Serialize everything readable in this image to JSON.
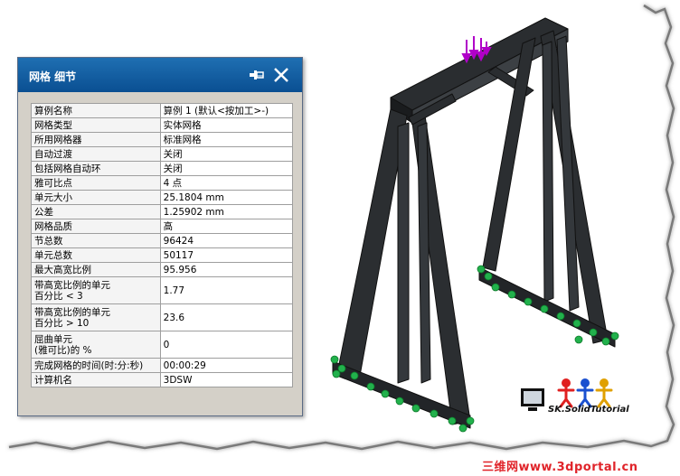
{
  "dialog": {
    "title": "网格 细节",
    "rows": [
      {
        "key": "算例名称",
        "value": "算例 1 (默认<按加工>-)"
      },
      {
        "key": "网格类型",
        "value": "实体网格"
      },
      {
        "key": "所用网格器",
        "value": "标准网格"
      },
      {
        "key": "自动过渡",
        "value": "关闭"
      },
      {
        "key": "包括网格自动环",
        "value": "关闭"
      },
      {
        "key": "雅可比点",
        "value": "4 点"
      },
      {
        "key": "单元大小",
        "value": "25.1804 mm"
      },
      {
        "key": "公差",
        "value": "1.25902 mm"
      },
      {
        "key": "网格品质",
        "value": "高"
      },
      {
        "key": "节总数",
        "value": "96424"
      },
      {
        "key": "单元总数",
        "value": "50117"
      },
      {
        "key": "最大高宽比例",
        "value": "95.956"
      },
      {
        "key": "带高宽比例的单元\n百分比 < 3",
        "value": "1.77"
      },
      {
        "key": "带高宽比例的单元\n百分比 > 10",
        "value": "23.6"
      },
      {
        "key": "屈曲单元\n(雅可比)的 %",
        "value": "0"
      },
      {
        "key": "完成网格的时间(时:分:秒)",
        "value": "00:00:29"
      },
      {
        "key": "计算机名",
        "value": "3DSW"
      }
    ]
  },
  "logo": {
    "text": "SK.SolidTutorial"
  },
  "watermark": {
    "text": "三维网www.3dportal.cn"
  },
  "colors": {
    "titlebar": "#0a5aa3",
    "support": "#22b14c",
    "load": "#b000c8"
  },
  "icons": [
    "pin-icon",
    "close-icon"
  ]
}
